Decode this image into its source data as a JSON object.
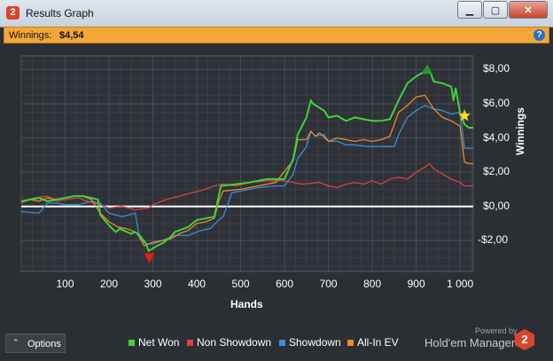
{
  "window": {
    "title": "Results Graph",
    "app_icon_text": "2",
    "buttons": {
      "minimize": "▁",
      "maximize": "▢",
      "close": "✕"
    }
  },
  "winnings_bar": {
    "label": "Winnings:",
    "value": "$4,54"
  },
  "bottom": {
    "options_label": "Options",
    "powered_by": "Powered by",
    "brand_name": "Hold'em Manager",
    "brand_logo_text": "2"
  },
  "chart_data": {
    "type": "line",
    "xlabel": "Hands",
    "ylabel": "Winnings",
    "xlim": [
      0,
      1030
    ],
    "ylim": [
      -3.8,
      8.8
    ],
    "x_ticks": [
      "100",
      "200",
      "300",
      "400",
      "500",
      "600",
      "700",
      "800",
      "900",
      "1 000"
    ],
    "x_tick_values": [
      100,
      200,
      300,
      400,
      500,
      600,
      700,
      800,
      900,
      1000
    ],
    "y_ticks": [
      "$8,00",
      "$6,00",
      "$4,00",
      "$2,00",
      "$0,00",
      "-$2,00"
    ],
    "y_tick_values": [
      8,
      6,
      4,
      2,
      0,
      -2
    ],
    "grid": true,
    "legend_position": "bottom",
    "markers": {
      "max": {
        "x": 925,
        "y": 8.0,
        "color": "#1f9a2a"
      },
      "min": {
        "x": 292,
        "y": -3.0,
        "color": "#e0201a"
      },
      "current": {
        "x": 1010,
        "y": 5.3,
        "color": "#ffe21a"
      }
    },
    "series": [
      {
        "name": "Net Won",
        "color": "#3fd23a",
        "x": [
          0,
          20,
          40,
          60,
          80,
          100,
          120,
          140,
          160,
          175,
          180,
          200,
          215,
          225,
          250,
          260,
          270,
          285,
          290,
          310,
          325,
          340,
          350,
          380,
          400,
          420,
          440,
          450,
          455,
          490,
          520,
          560,
          600,
          620,
          630,
          650,
          660,
          665,
          690,
          700,
          720,
          740,
          760,
          780,
          800,
          820,
          840,
          860,
          880,
          900,
          920,
          930,
          940,
          960,
          980,
          985,
          990,
          1000,
          1010,
          1020,
          1030
        ],
        "y": [
          0.3,
          0.4,
          0.5,
          0.3,
          0.4,
          0.5,
          0.6,
          0.6,
          0.5,
          0.4,
          -0.5,
          -1.1,
          -1.5,
          -1.3,
          -1.6,
          -1.5,
          -1.7,
          -2.2,
          -2.6,
          -2.3,
          -2.1,
          -1.8,
          -1.5,
          -1.2,
          -0.8,
          -0.7,
          -0.6,
          0.6,
          1.2,
          1.3,
          1.4,
          1.6,
          1.6,
          2.8,
          4.2,
          5.2,
          6.2,
          6.0,
          5.6,
          5.2,
          5.3,
          5.0,
          5.2,
          5.1,
          5.0,
          5.0,
          5.1,
          6.2,
          7.2,
          7.6,
          7.9,
          8.0,
          7.3,
          7.2,
          7.0,
          6.2,
          6.9,
          5.5,
          4.8,
          4.6,
          4.6
        ]
      },
      {
        "name": "Non Showdown",
        "color": "#d8423f",
        "x": [
          0,
          30,
          60,
          80,
          100,
          130,
          150,
          180,
          200,
          230,
          260,
          290,
          300,
          330,
          360,
          390,
          420,
          440,
          460,
          490,
          520,
          560,
          600,
          640,
          680,
          700,
          720,
          740,
          760,
          780,
          800,
          820,
          840,
          860,
          880,
          900,
          920,
          930,
          940,
          960,
          980,
          1000,
          1010,
          1030
        ],
        "y": [
          0.2,
          0.5,
          0.6,
          0.3,
          0.4,
          0.5,
          0.3,
          0.1,
          -0.1,
          0.0,
          -0.2,
          -0.1,
          0.1,
          0.4,
          0.6,
          0.8,
          1.0,
          1.2,
          1.3,
          1.2,
          1.4,
          1.5,
          1.5,
          1.3,
          1.4,
          1.2,
          1.1,
          1.3,
          1.4,
          1.3,
          1.5,
          1.3,
          1.6,
          1.7,
          1.6,
          2.0,
          2.3,
          2.5,
          2.2,
          1.9,
          1.6,
          1.4,
          1.2,
          1.2
        ]
      },
      {
        "name": "Showdown",
        "color": "#3a8fd8",
        "x": [
          0,
          40,
          60,
          80,
          100,
          130,
          160,
          180,
          200,
          230,
          260,
          270,
          285,
          300,
          330,
          350,
          380,
          410,
          430,
          450,
          460,
          480,
          500,
          540,
          580,
          600,
          620,
          630,
          650,
          660,
          670,
          690,
          700,
          720,
          740,
          760,
          790,
          800,
          820,
          850,
          860,
          880,
          900,
          920,
          930,
          940,
          960,
          980,
          1000,
          1010,
          1030
        ],
        "y": [
          -0.3,
          -0.4,
          0.2,
          0.2,
          0.1,
          0.1,
          0.3,
          0.2,
          -0.4,
          -0.6,
          -0.4,
          -1.9,
          -2.2,
          -2.2,
          -1.9,
          -1.7,
          -1.7,
          -1.4,
          -1.3,
          -0.8,
          -0.6,
          0.8,
          0.9,
          1.1,
          1.2,
          1.2,
          1.9,
          2.8,
          3.5,
          4.4,
          4.1,
          4.2,
          3.8,
          3.8,
          3.6,
          3.6,
          3.5,
          3.5,
          3.5,
          3.5,
          4.2,
          5.2,
          5.6,
          5.9,
          5.8,
          5.7,
          5.6,
          5.4,
          5.5,
          3.4,
          3.4
        ]
      },
      {
        "name": "All-In EV",
        "color": "#e98a2b",
        "x": [
          0,
          20,
          40,
          60,
          80,
          100,
          120,
          140,
          160,
          180,
          200,
          220,
          240,
          260,
          270,
          280,
          300,
          320,
          340,
          360,
          380,
          400,
          420,
          440,
          450,
          460,
          500,
          540,
          580,
          620,
          630,
          650,
          660,
          670,
          680,
          700,
          720,
          740,
          760,
          780,
          800,
          820,
          840,
          860,
          880,
          900,
          920,
          940,
          960,
          980,
          1000,
          1010,
          1020,
          1030
        ],
        "y": [
          0.3,
          0.4,
          0.3,
          0.5,
          0.4,
          0.5,
          0.6,
          0.6,
          0.4,
          -0.4,
          -0.9,
          -1.2,
          -1.3,
          -1.5,
          -1.8,
          -2.3,
          -2.1,
          -2.0,
          -1.9,
          -1.6,
          -1.4,
          -1.0,
          -0.9,
          -0.7,
          0.3,
          0.9,
          1.0,
          1.2,
          1.4,
          2.7,
          3.9,
          3.9,
          4.4,
          4.1,
          4.3,
          3.8,
          4.0,
          3.9,
          3.8,
          3.9,
          3.8,
          3.9,
          4.1,
          5.5,
          5.9,
          6.4,
          6.5,
          5.7,
          5.2,
          5.0,
          4.7,
          2.6,
          2.5,
          2.5
        ]
      }
    ]
  }
}
